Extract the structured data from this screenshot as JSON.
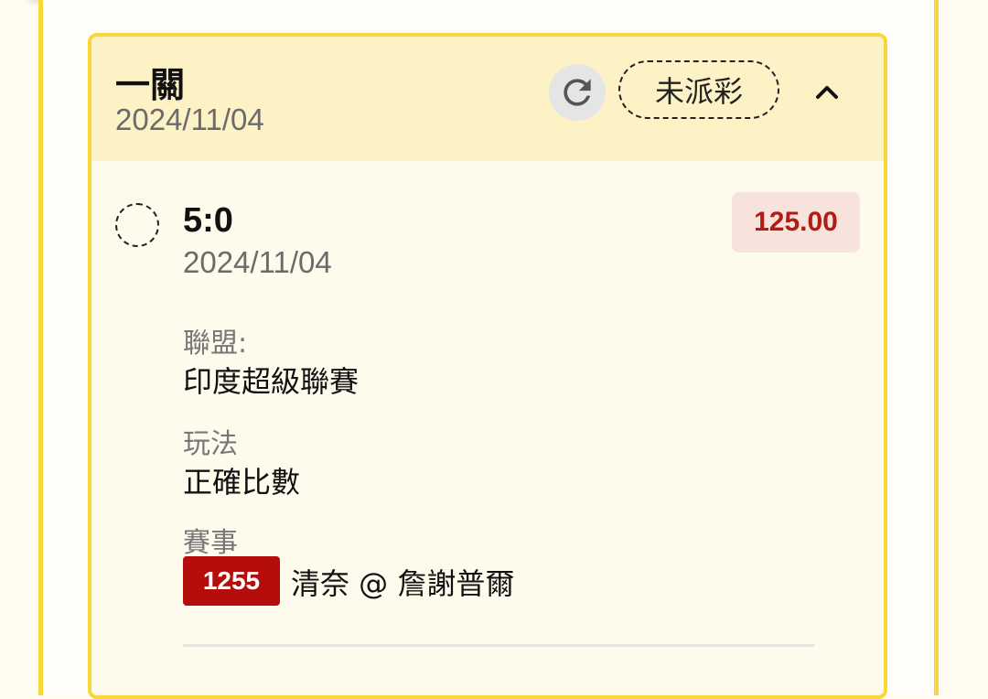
{
  "bet": {
    "type": "一關",
    "date": "2024/11/04",
    "status": "未派彩",
    "refresh_icon": "refresh-icon",
    "collapse_icon": "chevron-up-icon"
  },
  "selection": {
    "score": "5:0",
    "date": "2024/11/04",
    "odds": "125.00",
    "league_label": "聯盟:",
    "league": "印度超級聯賽",
    "play_label": "玩法",
    "play": "正確比數",
    "match_label": "賽事",
    "match_id": "1255",
    "match": "清奈 @ 詹謝普爾"
  },
  "colors": {
    "accent_yellow": "#f7d73a",
    "header_bg": "#fdf1c6",
    "odds_text": "#b11d16",
    "odds_bg": "#f8e2dc",
    "match_id_bg": "#b50c0c"
  }
}
